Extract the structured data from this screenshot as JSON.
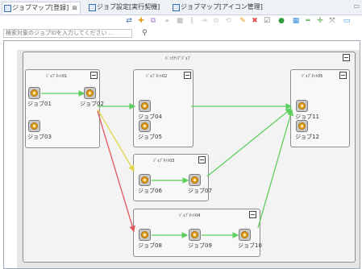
{
  "tabs": [
    {
      "label": "ジョブマップ[登録]",
      "close": "⊠"
    },
    {
      "label": "ジョブ設定[実行契機]"
    },
    {
      "label": "ジョブマップ[アイコン管理]"
    }
  ],
  "search": {
    "placeholder": "検索対象のジョブIDを入力してください ..."
  },
  "jobmap": {
    "unit_title": "ﾊﾞｯｸｱｯﾌﾟｼﾞｮﾌﾞ",
    "nets": [
      {
        "title": "ｼﾞｮﾌﾞﾈｯﾄ01"
      },
      {
        "title": "ｼﾞｮﾌﾞﾈｯﾄ02"
      },
      {
        "title": "ｼﾞｮﾌﾞﾈｯﾄ03"
      },
      {
        "title": "ｼﾞｮﾌﾞﾈｯﾄ04"
      },
      {
        "title": "ｼﾞｮﾌﾞﾈｯﾄ05"
      }
    ],
    "jobs": [
      "ジョブ01",
      "ジョブ02",
      "ジョブ03",
      "ジョブ04",
      "ジョブ05",
      "ジョブ06",
      "ジョブ07",
      "ジョブ08",
      "ジョブ09",
      "ジョブ10",
      "ジョブ11",
      "ジョブ12"
    ]
  },
  "colors": {
    "edge_green": "#5ccf5c",
    "edge_yellow": "#e0d84a",
    "edge_red": "#e0585b"
  }
}
